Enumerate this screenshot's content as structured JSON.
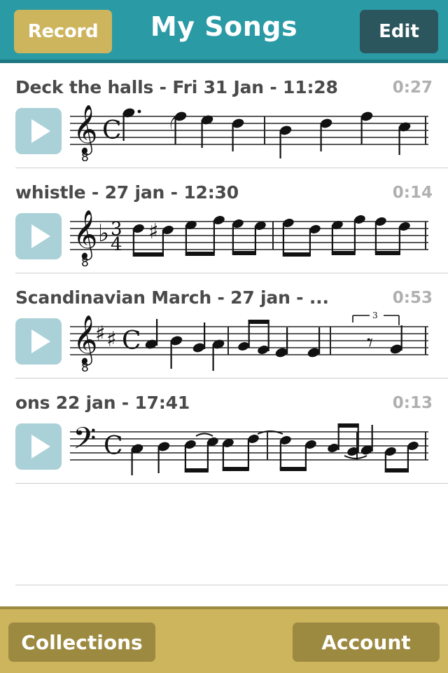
{
  "header": {
    "record_label": "Record",
    "title": "My Songs",
    "edit_label": "Edit",
    "bg_color": "#2a9aa5",
    "record_color": "#cdb55e",
    "edit_color": "#2b565e"
  },
  "songs": [
    {
      "title": "Deck the halls - Fri 31 Jan - 11:28",
      "duration": "0:27",
      "clef": "treble-8",
      "key_signature": "",
      "time_signature": "common"
    },
    {
      "title": "whistle - 27 jan - 12:30",
      "duration": "0:14",
      "clef": "treble-8",
      "key_signature": "1-flat",
      "time_signature": "3/4"
    },
    {
      "title": "Scandinavian March - 27 jan - ...",
      "duration": "0:53",
      "clef": "treble-8",
      "key_signature": "2-sharp",
      "time_signature": "common",
      "tuplet_label": "3"
    },
    {
      "title": "ons 22 jan - 17:41",
      "duration": "0:13",
      "clef": "bass",
      "key_signature": "",
      "time_signature": "common"
    }
  ],
  "play_icon": "play-triangle-icon",
  "tabbar": {
    "collections_label": "Collections",
    "account_label": "Account",
    "bg_color": "#cdb55e",
    "button_color": "#9c8a41"
  }
}
